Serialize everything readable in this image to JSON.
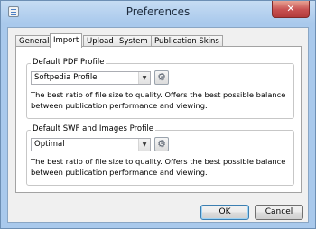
{
  "window": {
    "title": "Preferences",
    "close_glyph": "✕",
    "icon": "app-document-icon"
  },
  "tabs": [
    {
      "label": "General",
      "active": false
    },
    {
      "label": "Import",
      "active": true
    },
    {
      "label": "Upload",
      "active": false
    },
    {
      "label": "System",
      "active": false
    },
    {
      "label": "Publication Skins",
      "active": false
    }
  ],
  "pdf_profile": {
    "group_title": "Default PDF Profile",
    "selected": "Softpedia Profile",
    "description": "The best ratio of file size to quality. Offers the best possible balance between publication performance and viewing."
  },
  "swf_profile": {
    "group_title": "Default SWF and Images Profile",
    "selected": "Optimal",
    "description": "The best ratio of file size to quality. Offers the best possible balance between publication performance and viewing."
  },
  "icons": {
    "dropdown": "▼",
    "settings": "⚙"
  },
  "buttons": {
    "ok": "OK",
    "cancel": "Cancel"
  },
  "colors": {
    "title_bar": "#a9c9ec",
    "close_button": "#c75050",
    "default_button_border": "#3c7fb1"
  }
}
